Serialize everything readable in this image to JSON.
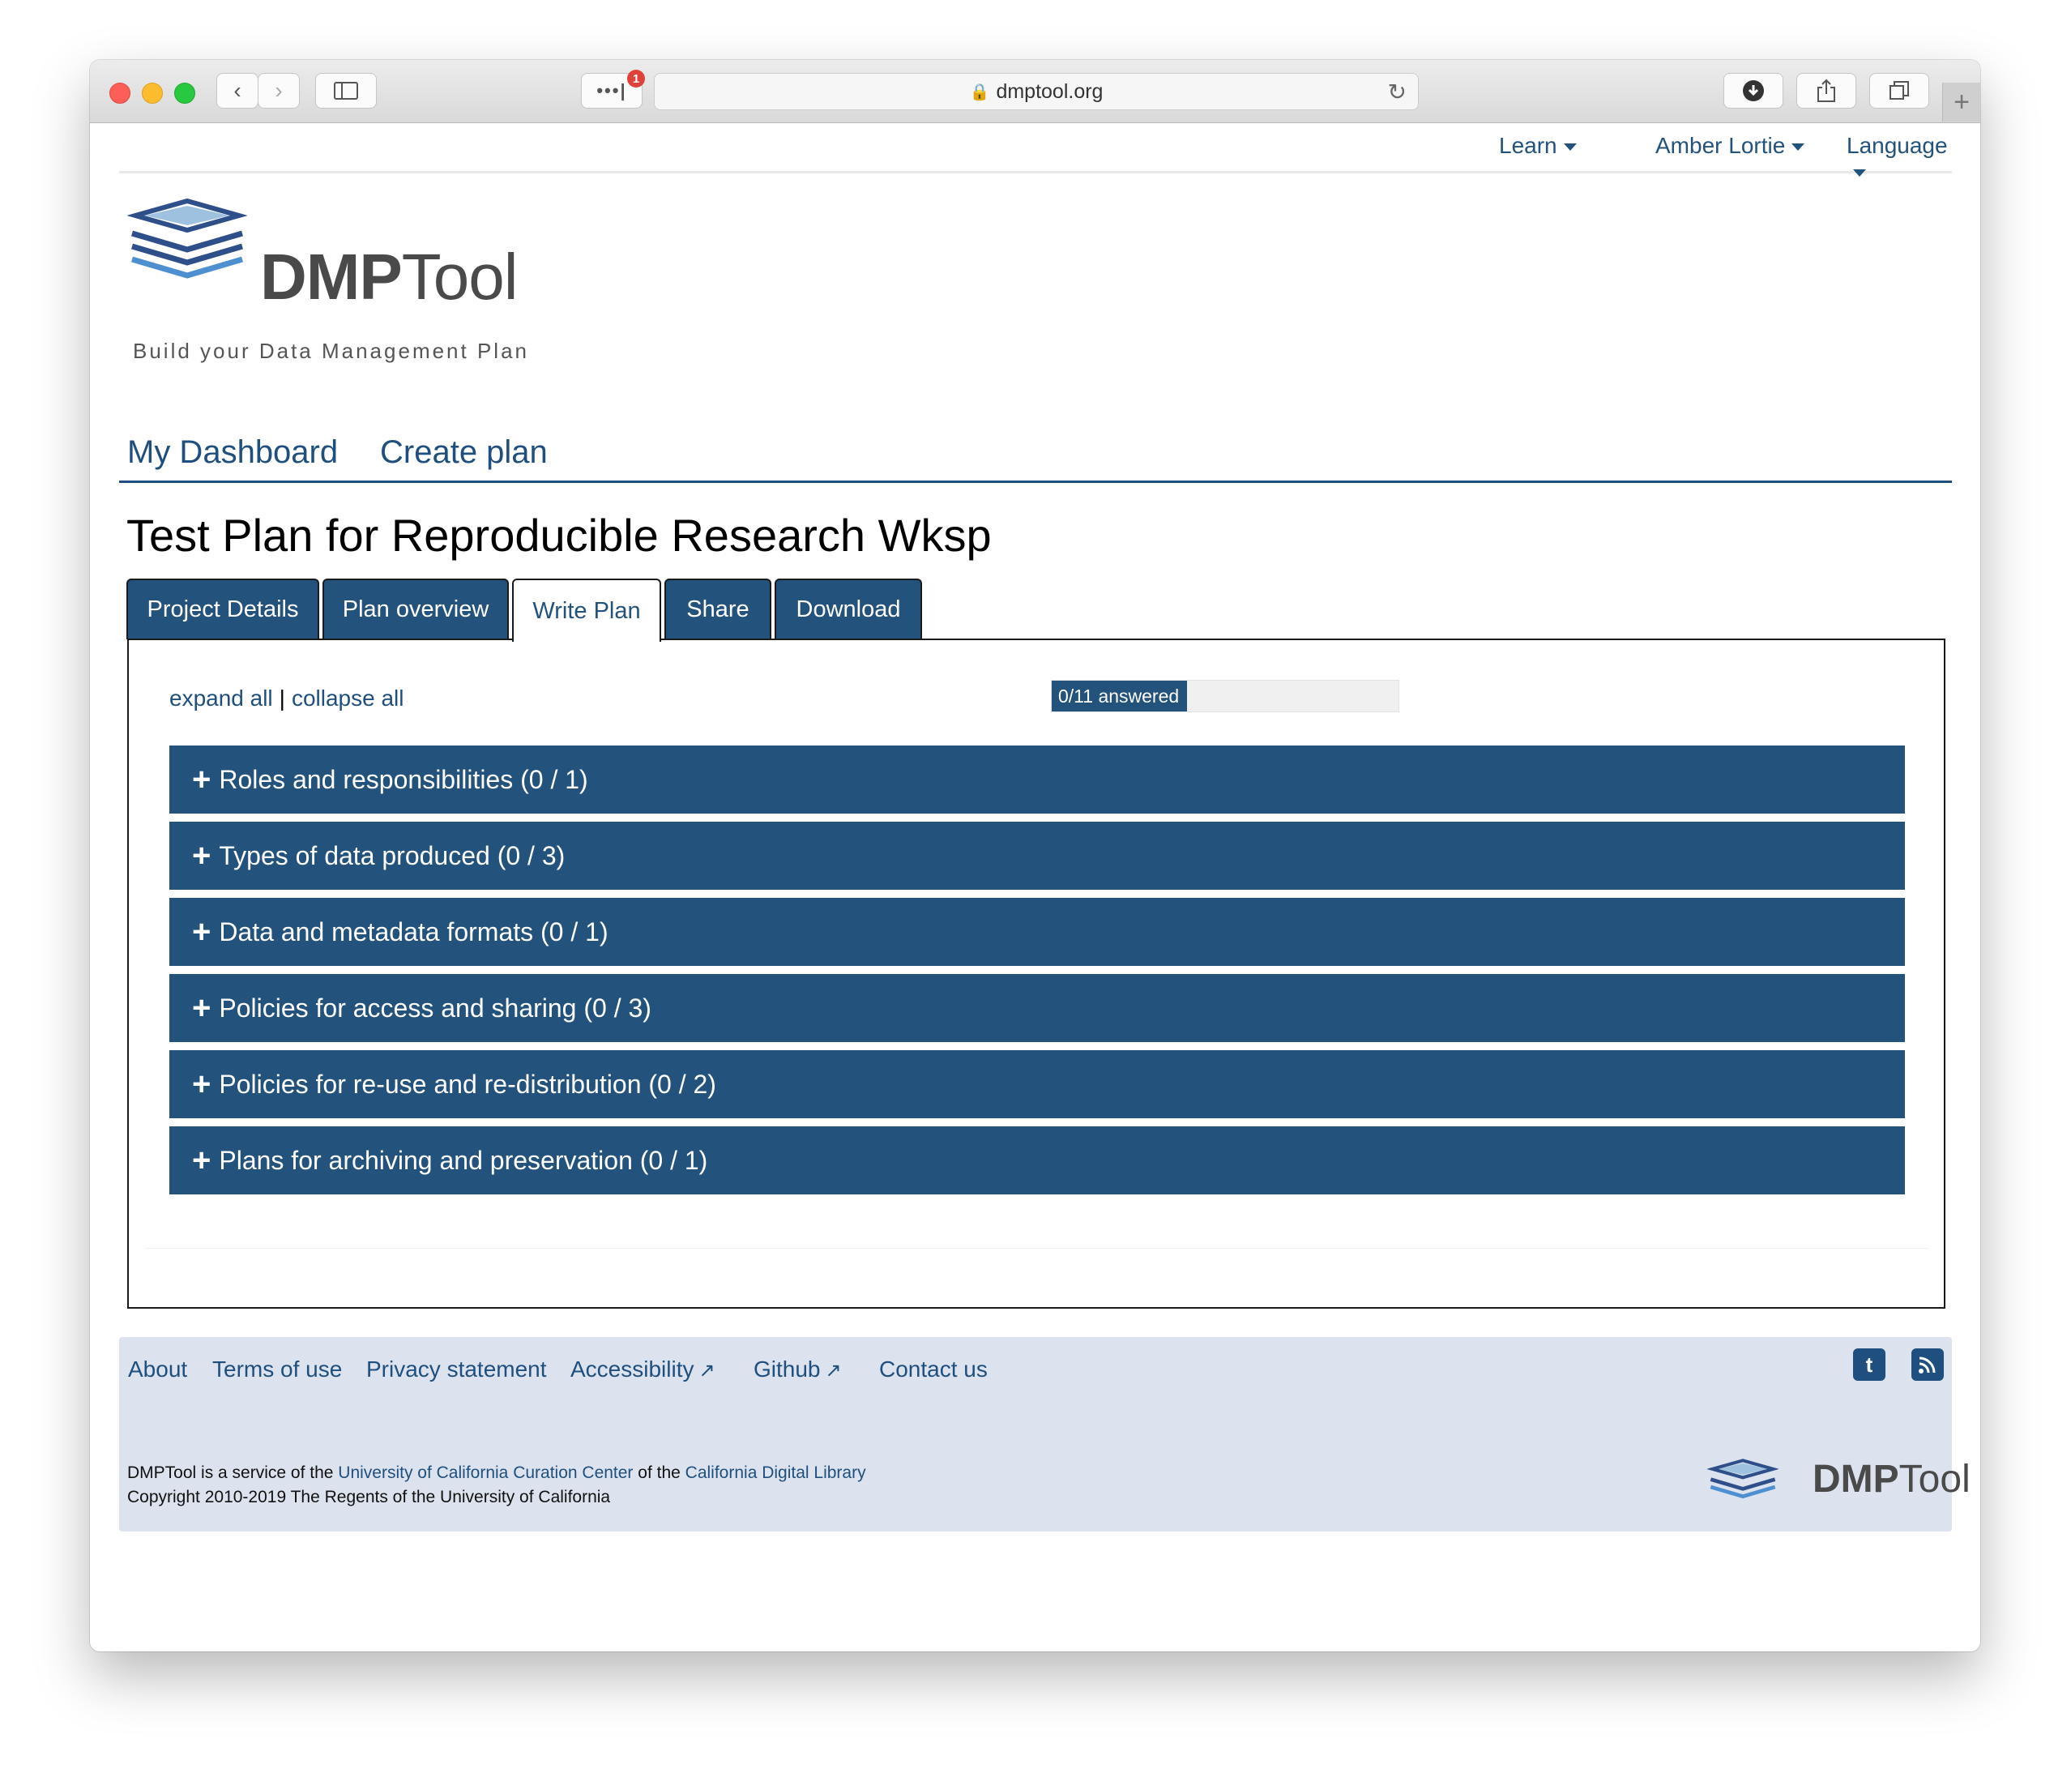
{
  "browser": {
    "url": "dmptool.org",
    "notification_count": "1"
  },
  "topnav": {
    "learn": "Learn",
    "user": "Amber Lortie",
    "language": "Language"
  },
  "brand": {
    "logo_bold": "DMP",
    "logo_light": "Tool",
    "tagline": "Build your Data Management Plan"
  },
  "mainnav": {
    "dashboard": "My Dashboard",
    "create": "Create plan"
  },
  "plan": {
    "title": "Test Plan for Reproducible Research Wksp",
    "tabs": [
      "Project Details",
      "Plan overview",
      "Write Plan",
      "Share",
      "Download"
    ],
    "active_tab": "Write Plan"
  },
  "write": {
    "expand_all": "expand all",
    "separator": "|",
    "collapse_all": "collapse all",
    "progress_label": "0/11 answered",
    "progress_fraction": 0.39,
    "sections": [
      "Roles and responsibilities (0 / 1)",
      "Types of data produced (0 / 3)",
      "Data and metadata formats (0 / 1)",
      "Policies for access and sharing (0 / 3)",
      "Policies for re-use and re-distribution (0 / 2)",
      "Plans for archiving and preservation (0 / 1)"
    ]
  },
  "footer": {
    "links": [
      "About",
      "Terms of use",
      "Privacy statement",
      "Accessibility",
      "Github",
      "Contact us"
    ],
    "service_prefix": "DMPTool is a service of the",
    "service_org": "University of California Curation Center",
    "service_mid": "of the",
    "service_lib": "California Digital Library",
    "copyright": "Copyright 2010-2019 The Regents of the University of California"
  },
  "colors": {
    "brand_blue": "#23527c",
    "footer_bg": "#dce3ee"
  },
  "icons": {
    "twitter": "twitter-icon",
    "rss": "rss-icon",
    "external": "external-link-icon"
  }
}
